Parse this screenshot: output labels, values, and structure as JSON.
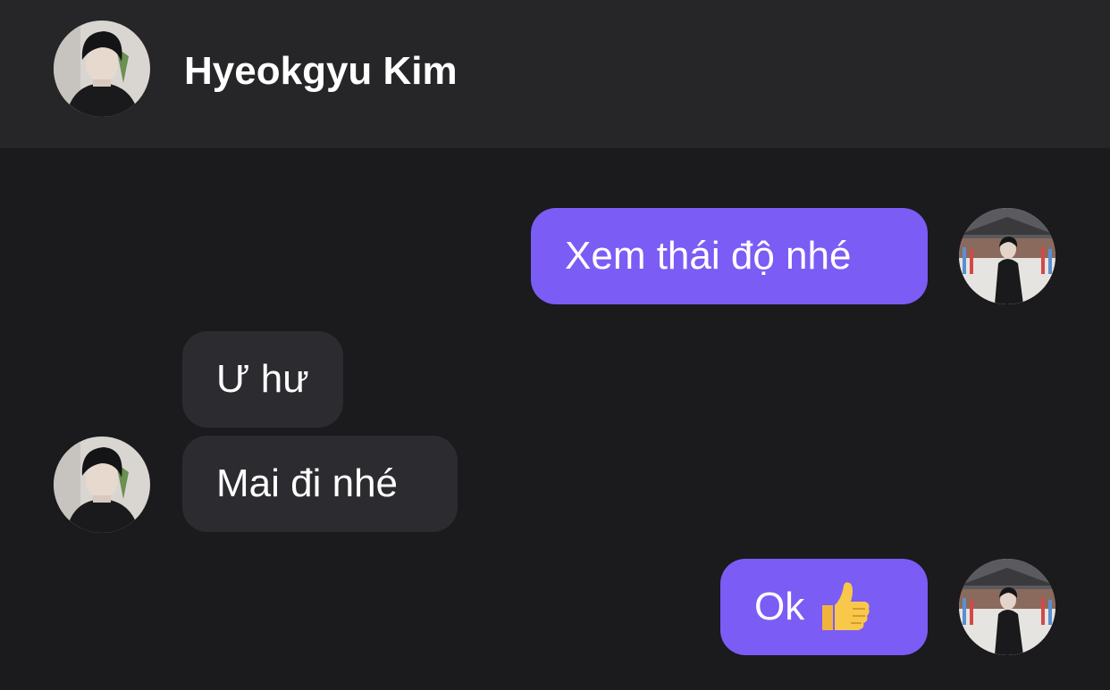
{
  "header": {
    "contact_name": "Hyeokgyu Kim"
  },
  "messages": [
    {
      "direction": "outgoing",
      "text": "Xem thái độ nhé"
    },
    {
      "direction": "incoming",
      "text": "Ư hư"
    },
    {
      "direction": "incoming",
      "text": "Mai đi nhé"
    },
    {
      "direction": "outgoing",
      "text": "Ok",
      "emoji": "thumbs-up-icon"
    }
  ],
  "colors": {
    "outgoing_bubble": "#7b5cf5",
    "incoming_bubble": "#2c2b2f",
    "background": "#1b1a1d",
    "header_background": "#262528"
  }
}
